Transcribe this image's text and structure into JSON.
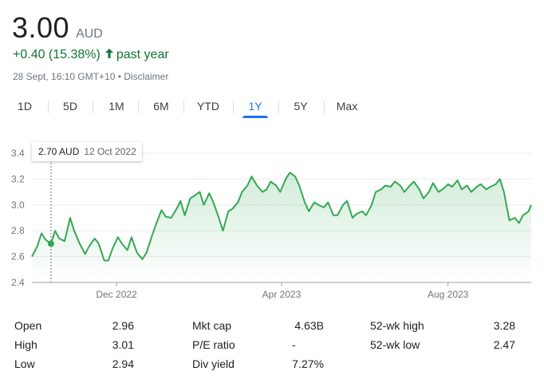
{
  "header": {
    "price": "3.00",
    "currency": "AUD",
    "change": "+0.40 (15.38%)",
    "period": "past year",
    "timestamp": "28 Sept, 16:10 GMT+10",
    "disclaimer": "Disclaimer",
    "colors": {
      "positive": "#137333",
      "line": "#34a853",
      "accent": "#1a73e8"
    }
  },
  "tabs": [
    {
      "label": "1D",
      "active": false
    },
    {
      "label": "5D",
      "active": false
    },
    {
      "label": "1M",
      "active": false
    },
    {
      "label": "6M",
      "active": false
    },
    {
      "label": "YTD",
      "active": false
    },
    {
      "label": "1Y",
      "active": true
    },
    {
      "label": "5Y",
      "active": false
    },
    {
      "label": "Max",
      "active": false
    }
  ],
  "tooltip": {
    "value": "2.70 AUD",
    "date": "12 Oct 2022"
  },
  "chart_data": {
    "type": "area",
    "ylim": [
      2.4,
      3.4
    ],
    "yticks": [
      "3.4",
      "3.2",
      "3.0",
      "2.8",
      "2.6",
      "2.4"
    ],
    "xticks": [
      {
        "label": "Dec 2022",
        "day": 62
      },
      {
        "label": "Apr 2023",
        "day": 183
      },
      {
        "label": "Aug 2023",
        "day": 305
      }
    ],
    "grid": true,
    "hover": {
      "day": 14,
      "value": 2.7
    },
    "x_days": [
      0,
      4,
      7,
      10,
      14,
      17,
      20,
      24,
      28,
      31,
      35,
      39,
      42,
      46,
      49,
      53,
      56,
      59,
      63,
      66,
      70,
      73,
      77,
      81,
      84,
      88,
      91,
      95,
      98,
      102,
      105,
      109,
      112,
      116,
      119,
      123,
      126,
      130,
      133,
      137,
      140,
      144,
      147,
      151,
      154,
      158,
      161,
      165,
      169,
      172,
      175,
      179,
      182,
      186,
      189,
      193,
      196,
      200,
      203,
      207,
      210,
      214,
      217,
      221,
      224,
      228,
      231,
      235,
      238,
      242,
      245,
      249,
      252,
      256,
      259,
      263,
      266,
      270,
      273,
      277,
      280,
      284,
      287,
      291,
      294,
      298,
      301,
      305,
      308,
      312,
      315,
      319,
      322,
      326,
      329,
      333,
      336,
      340,
      343,
      346,
      350,
      354,
      357,
      360,
      364,
      366
    ],
    "values": [
      2.6,
      2.68,
      2.78,
      2.73,
      2.7,
      2.8,
      2.74,
      2.72,
      2.9,
      2.8,
      2.7,
      2.62,
      2.68,
      2.74,
      2.7,
      2.57,
      2.57,
      2.66,
      2.75,
      2.7,
      2.65,
      2.75,
      2.63,
      2.58,
      2.63,
      2.76,
      2.85,
      2.96,
      2.91,
      2.9,
      2.95,
      3.03,
      2.92,
      3.05,
      3.07,
      3.1,
      3.0,
      3.09,
      3.02,
      2.9,
      2.8,
      2.95,
      2.97,
      3.02,
      3.1,
      3.15,
      3.22,
      3.15,
      3.1,
      3.12,
      3.18,
      3.15,
      3.1,
      3.2,
      3.25,
      3.22,
      3.15,
      3.02,
      2.95,
      3.02,
      3.0,
      2.98,
      3.02,
      2.92,
      2.92,
      3.0,
      3.03,
      2.9,
      2.93,
      2.95,
      2.92,
      3.0,
      3.1,
      3.12,
      3.15,
      3.14,
      3.18,
      3.15,
      3.1,
      3.15,
      3.18,
      3.12,
      3.05,
      3.1,
      3.17,
      3.1,
      3.12,
      3.16,
      3.14,
      3.19,
      3.12,
      3.15,
      3.1,
      3.14,
      3.16,
      3.12,
      3.14,
      3.16,
      3.2,
      3.1,
      2.88,
      2.9,
      2.86,
      2.92,
      2.95,
      3.0
    ]
  },
  "stats": {
    "col1": [
      {
        "label": "Open",
        "value": "2.96"
      },
      {
        "label": "High",
        "value": "3.01"
      },
      {
        "label": "Low",
        "value": "2.94"
      }
    ],
    "col2": [
      {
        "label": "Mkt cap",
        "value": "4.63B"
      },
      {
        "label": "P/E ratio",
        "value": "-"
      },
      {
        "label": "Div yield",
        "value": "7.27%"
      }
    ],
    "col3": [
      {
        "label": "52-wk high",
        "value": "3.28"
      },
      {
        "label": "52-wk low",
        "value": "2.47"
      }
    ]
  }
}
